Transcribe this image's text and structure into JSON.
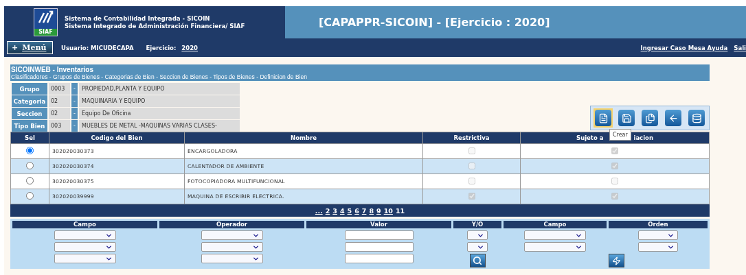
{
  "header": {
    "logo_text": "SIAF",
    "system_lines": [
      "Sistema de Contabilidad Integrada - SICOIN",
      "Sistema Integrado de Administración Financiera/ SIAF"
    ],
    "title": "[CAPAPPR-SICOIN] - [Ejercicio : 2020]"
  },
  "nav": {
    "menu_icon": "+",
    "menu_label": "Menú",
    "user": "Usuario: MICUDECAPA",
    "exercise_label": "Ejercicio:",
    "exercise_value": "2020",
    "links": [
      "Ingresar Caso Mesa Ayuda",
      "Sali"
    ]
  },
  "panel": {
    "title": "SICOINWEB - Inventarios",
    "breadcrumb": "Clasificadores - Grupos de Bienes - Categorias de Bien - Seccion de Bienes - Tipos de Bienes - Definicion de Bien",
    "info": [
      {
        "label": "Grupo",
        "code": "0003",
        "dash": "-",
        "value": "PROPIEDAD,PLANTA Y EQUIPO"
      },
      {
        "label": "Categoria",
        "code": "02",
        "dash": "-",
        "value": "MAQUINARIA Y EQUIPO"
      },
      {
        "label": "Seccion",
        "code": "02",
        "dash": "-",
        "value": "Equipo De Oficina"
      },
      {
        "label": "Tipo Bien",
        "code": "003",
        "dash": "-",
        "value": "MUEBLES DE METAL -MAQUINAS VARIAS CLASES-"
      }
    ],
    "toolbar": [
      {
        "kind": "new",
        "highlighted": true
      },
      {
        "kind": "save",
        "highlighted": false
      },
      {
        "kind": "search",
        "highlighted": false
      },
      {
        "kind": "back",
        "highlighted": false
      },
      {
        "kind": "database",
        "highlighted": false
      }
    ],
    "tooltip": "Crear",
    "table": {
      "columns": [
        {
          "parts": [
            "Sel"
          ]
        },
        {
          "parts": [
            "Codigo del Bien"
          ]
        },
        {
          "parts": [
            "Nombre"
          ]
        },
        {
          "parts": [
            "Restrictiva"
          ]
        },
        {
          "parts": [
            "Sujeto a",
            "iacion"
          ]
        }
      ],
      "rows": [
        {
          "selected": true,
          "code": "302020030373",
          "name": "ENCARGOLADORA",
          "restrictiva": false,
          "sujeto": true
        },
        {
          "selected": false,
          "code": "302020030374",
          "name": "CALENTADOR DE AMBIENTE",
          "restrictiva": false,
          "sujeto": true
        },
        {
          "selected": false,
          "code": "302020030375",
          "name": "FOTOCOPIADORA MULTIFUNCIONAL",
          "restrictiva": false,
          "sujeto": false
        },
        {
          "selected": false,
          "code": "302020039999",
          "name": "MAQUINA DE ESCRIBIR ELECTRICA.",
          "restrictiva": true,
          "sujeto": true
        }
      ]
    },
    "pager": [
      {
        "label": "...",
        "selected": false
      },
      {
        "label": "2",
        "selected": false
      },
      {
        "label": "3",
        "selected": false
      },
      {
        "label": "4",
        "selected": false
      },
      {
        "label": "5",
        "selected": false
      },
      {
        "label": "6",
        "selected": false
      },
      {
        "label": "7",
        "selected": false
      },
      {
        "label": "8",
        "selected": false
      },
      {
        "label": "9",
        "selected": false
      },
      {
        "label": "10",
        "selected": false
      },
      {
        "label": "11",
        "selected": true
      }
    ],
    "filter": [
      {
        "label": "Campo",
        "controls": [
          {
            "kind": "select"
          },
          {
            "kind": "select"
          },
          {
            "kind": "select"
          }
        ]
      },
      {
        "label": "Operador",
        "controls": [
          {
            "kind": "select"
          },
          {
            "kind": "select"
          },
          {
            "kind": "select"
          }
        ]
      },
      {
        "label": "Valor",
        "controls": [
          {
            "kind": "input"
          },
          {
            "kind": "input"
          },
          {
            "kind": "input"
          }
        ]
      },
      {
        "label": "Y/O",
        "controls": [
          {
            "kind": "small_select"
          },
          {
            "kind": "small_select"
          },
          {
            "kind": "search_button"
          }
        ]
      },
      {
        "label": "Campo",
        "controls": [
          {
            "kind": "select"
          },
          {
            "kind": "select"
          }
        ]
      },
      {
        "label": "Orden",
        "controls": [
          {
            "kind": "order_select"
          },
          {
            "kind": "order_select"
          },
          {
            "kind": "sort_button"
          }
        ]
      }
    ]
  }
}
